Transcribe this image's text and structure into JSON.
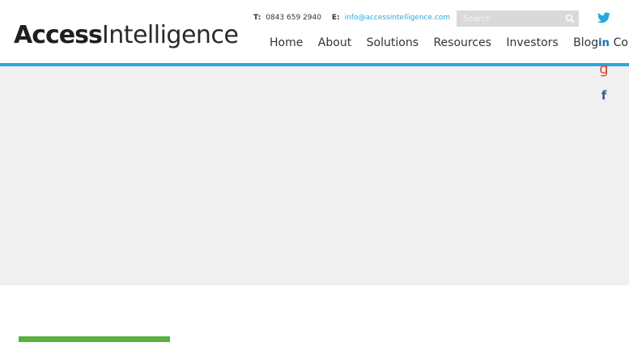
{
  "brand": {
    "logo_bold": "Access",
    "logo_thin": "Intelligence"
  },
  "contact": {
    "phone_label": "T:",
    "phone": "0843 659 2940",
    "email_label": "E:",
    "email": "info@accessintelligence.com"
  },
  "search": {
    "placeholder": "Search"
  },
  "nav": {
    "items": [
      "Home",
      "About",
      "Solutions",
      "Resources",
      "Investors",
      "Blog",
      "Contact"
    ]
  },
  "social": {
    "icons": [
      "twitter-icon",
      "linkedin-icon",
      "google-plus-icon",
      "facebook-icon"
    ]
  },
  "colors": {
    "accent": "#2aa7dd",
    "green": "#58b03f",
    "hero_bg": "#f0f0f0"
  }
}
